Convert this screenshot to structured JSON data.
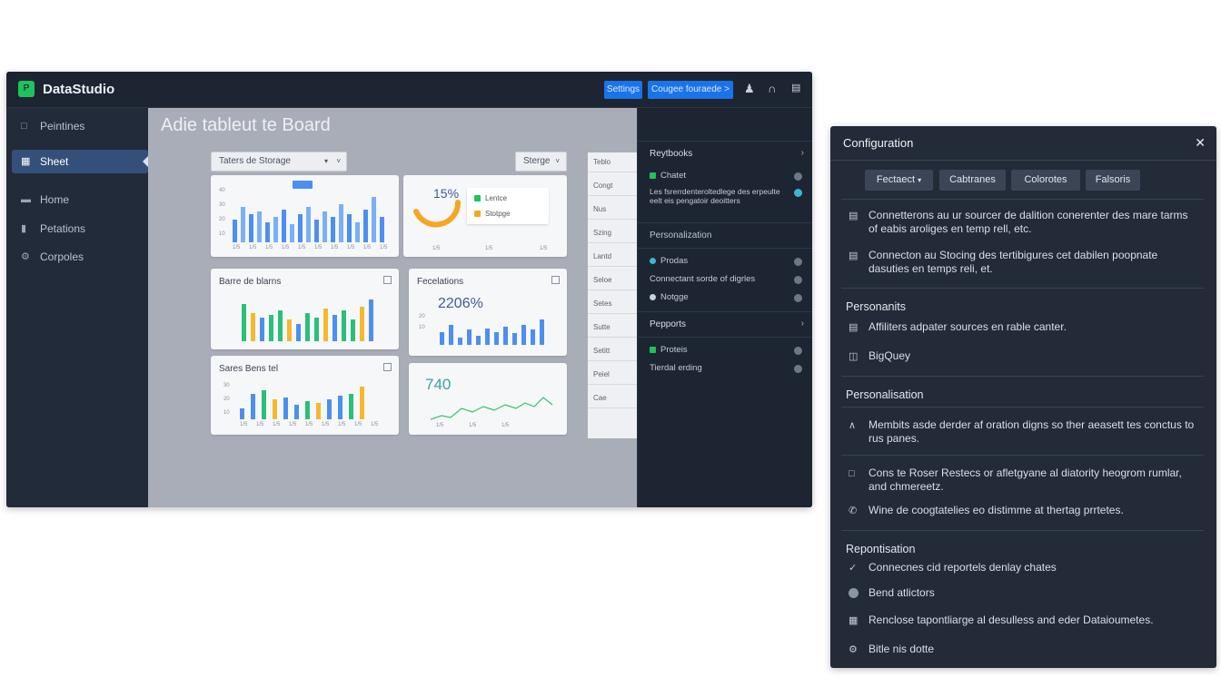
{
  "app": {
    "title": "DataStudio",
    "logo_glyph": "P",
    "header_buttons": [
      "Settings",
      "Cougee fouraede >"
    ],
    "accent_color": "#1a73e8",
    "icons": [
      "user-icon",
      "bookmark-icon",
      "message-icon"
    ]
  },
  "sidebar": {
    "items": [
      {
        "label": "Peintines",
        "icon": "page-icon"
      },
      {
        "label": "Sheet",
        "icon": "sheet-icon",
        "active": true
      },
      {
        "label": "Home",
        "icon": "folder-icon"
      },
      {
        "label": "Petations",
        "icon": "bars-icon"
      },
      {
        "label": "Corpoles",
        "icon": "gear-icon"
      }
    ]
  },
  "canvas": {
    "title": "Adie tableut te Board",
    "filter_select": "Taters de Storage",
    "filter_button": "Sterge",
    "cards": {
      "top_left": {
        "legend_chip": "label"
      },
      "donut": {
        "value": "15%",
        "legend": [
          "Lentce",
          "Stotpge"
        ]
      },
      "bar_mixed": {
        "title": "Barre de blarns"
      },
      "fecelations": {
        "title": "Fecelations",
        "value": "2206%"
      },
      "sares": {
        "title": "Sares Bens tel"
      },
      "line": {
        "value": "740"
      }
    },
    "list": [
      "Teblo",
      "Congt",
      "Nus",
      "Szing",
      "Lantd",
      "Seloe",
      "Setes",
      "Sutte",
      "Setitt",
      "Peiel",
      "Cae"
    ]
  },
  "right_panel": {
    "sections": [
      {
        "head": "Reytbooks",
        "items": [
          "Chatet",
          "Les fsrerrdenteroltedlege des erpeulte eelt eis pengatoir deoitters"
        ]
      },
      {
        "head": "Personalization",
        "items": [
          "Prodas",
          "Connectant sorde of digrles",
          "Notgge"
        ]
      },
      {
        "head": "Pepports",
        "items": [
          "Proteis",
          "Tierdal erding"
        ]
      }
    ]
  },
  "config": {
    "title": "Configuration",
    "tabs": [
      "Fectaect",
      "Cabtranes",
      "Colorotes",
      "Falsoris"
    ],
    "connectors": [
      "Connetterons au ur sourcer de dalition conerenter des mare tarms of eabis aroliges en temp rell, etc.",
      "Connecton au Stocing des tertibigures cet dabilen poopnate dasuties en temps reli, et."
    ],
    "section_personnalits": "Personanits",
    "personnalits_items": [
      "Affiliters adpater sources en rable canter.",
      "BigQuey"
    ],
    "section_personalisation": "Personalisation",
    "personalisation_items": [
      "Membits asde derder af oration digns so ther aeasett tes conctus to rus panes.",
      "Cons te Roser Restecs or afletgyane al diatority heogrom rumlar, and chmereetz.",
      "Wine de coogtatelies eo distimme at thertag prrtetes."
    ],
    "section_reportisation": "Repontisation",
    "reportisation_items": [
      "Connecnes cid reportels denlay chates",
      "Bend atlictors",
      "Renclose tapontliarge al desulless and eder Dataioumetes.",
      "Bitle nis dotte"
    ]
  }
}
